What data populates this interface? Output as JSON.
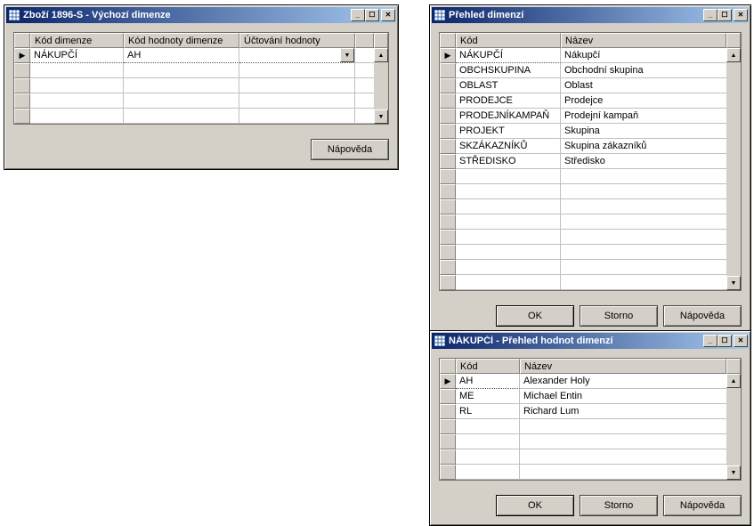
{
  "win1": {
    "title": "Zboží 1896-S - Výchozí dimenze",
    "columns": [
      "Kód dimenze",
      "Kód hodnoty dimenze",
      "Účtování hodnoty"
    ],
    "rows": [
      {
        "c0": "NÁKUPČÍ",
        "c1": "AH",
        "c2": ""
      }
    ],
    "buttons": {
      "help": "Nápověda"
    }
  },
  "win2": {
    "title": "Přehled dimenzí",
    "columns": [
      "Kód",
      "Název"
    ],
    "rows": [
      {
        "c0": "NÁKUPČÍ",
        "c1": "Nákupčí"
      },
      {
        "c0": "OBCHSKUPINA",
        "c1": "Obchodní skupina"
      },
      {
        "c0": "OBLAST",
        "c1": "Oblast"
      },
      {
        "c0": "PRODEJCE",
        "c1": "Prodejce"
      },
      {
        "c0": "PRODEJNÍKAMPAŇ",
        "c1": "Prodejní kampaň"
      },
      {
        "c0": "PROJEKT",
        "c1": "Skupina"
      },
      {
        "c0": "SKZÁKAZNÍKŮ",
        "c1": "Skupina zákazníků"
      },
      {
        "c0": "STŘEDISKO",
        "c1": "Středisko"
      }
    ],
    "buttons": {
      "ok": "OK",
      "cancel": "Storno",
      "help": "Nápověda"
    }
  },
  "win3": {
    "title": "NÁKUPČÍ - Přehled hodnot dimenzí",
    "columns": [
      "Kód",
      "Název"
    ],
    "rows": [
      {
        "c0": "AH",
        "c1": "Alexander Holy"
      },
      {
        "c0": "ME",
        "c1": "Michael Entin"
      },
      {
        "c0": "RL",
        "c1": "Richard Lum"
      }
    ],
    "buttons": {
      "ok": "OK",
      "cancel": "Storno",
      "help": "Nápověda"
    }
  }
}
